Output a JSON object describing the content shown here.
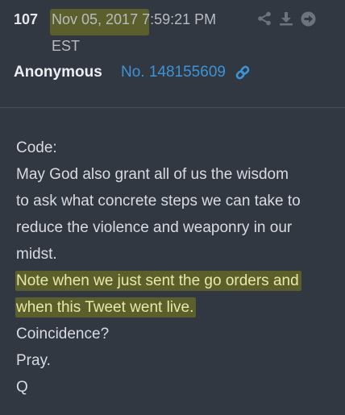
{
  "post": {
    "number": "107",
    "date": "Nov 05, 2017",
    "time": "7:59:21 PM",
    "timezone": "EST",
    "author": "Anonymous",
    "post_id": "No. 148155609"
  },
  "icons": {
    "share": "share-icon",
    "download": "download-icon",
    "next": "arrow-right-circle-icon",
    "link": "link-icon"
  },
  "colors": {
    "background": "#313842",
    "highlight": "#5b5f2c",
    "highlight_text": "#e8e9a4",
    "link": "#3d93d6"
  },
  "message": {
    "lines": [
      "Code:",
      "May God also grant all of us the wisdom",
      "to ask what concrete steps we can take to",
      "reduce the violence and weaponry in our",
      "midst.",
      "Note when we just sent the go orders and",
      "when this Tweet went live.",
      "Coincidence?",
      "Pray.",
      "Q"
    ]
  }
}
